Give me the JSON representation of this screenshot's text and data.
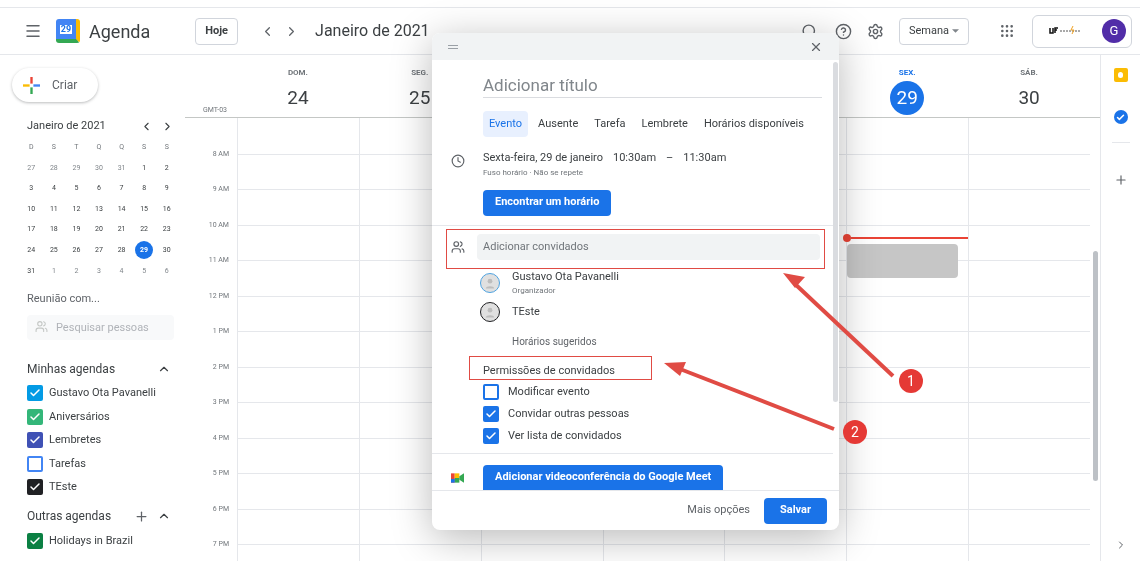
{
  "header": {
    "logo_day": "29",
    "app_name": "Agenda",
    "today_button": "Hoje",
    "period": "Janeiro de 2021",
    "view": "Semana",
    "avatar": "G"
  },
  "sidebar": {
    "create_button": "Criar",
    "mini_calendar": {
      "title": "Janeiro de 2021",
      "weekdays": [
        "D",
        "S",
        "T",
        "Q",
        "Q",
        "S",
        "S"
      ],
      "weeks": [
        [
          {
            "day": "27",
            "outside": true,
            "selected": false
          },
          {
            "day": "28",
            "outside": true,
            "selected": false
          },
          {
            "day": "29",
            "outside": true,
            "selected": false
          },
          {
            "day": "30",
            "outside": true,
            "selected": false
          },
          {
            "day": "31",
            "outside": true,
            "selected": false
          },
          {
            "day": "1",
            "outside": false,
            "selected": false
          },
          {
            "day": "2",
            "outside": false,
            "selected": false
          }
        ],
        [
          {
            "day": "3",
            "outside": false,
            "selected": false
          },
          {
            "day": "4",
            "outside": false,
            "selected": false
          },
          {
            "day": "5",
            "outside": false,
            "selected": false
          },
          {
            "day": "6",
            "outside": false,
            "selected": false
          },
          {
            "day": "7",
            "outside": false,
            "selected": false
          },
          {
            "day": "8",
            "outside": false,
            "selected": false
          },
          {
            "day": "9",
            "outside": false,
            "selected": false
          }
        ],
        [
          {
            "day": "10",
            "outside": false,
            "selected": false
          },
          {
            "day": "11",
            "outside": false,
            "selected": false
          },
          {
            "day": "12",
            "outside": false,
            "selected": false
          },
          {
            "day": "13",
            "outside": false,
            "selected": false
          },
          {
            "day": "14",
            "outside": false,
            "selected": false
          },
          {
            "day": "15",
            "outside": false,
            "selected": false
          },
          {
            "day": "16",
            "outside": false,
            "selected": false
          }
        ],
        [
          {
            "day": "17",
            "outside": false,
            "selected": false
          },
          {
            "day": "18",
            "outside": false,
            "selected": false
          },
          {
            "day": "19",
            "outside": false,
            "selected": false
          },
          {
            "day": "20",
            "outside": false,
            "selected": false
          },
          {
            "day": "21",
            "outside": false,
            "selected": false
          },
          {
            "day": "22",
            "outside": false,
            "selected": false
          },
          {
            "day": "23",
            "outside": false,
            "selected": false
          }
        ],
        [
          {
            "day": "24",
            "outside": false,
            "selected": false
          },
          {
            "day": "25",
            "outside": false,
            "selected": false
          },
          {
            "day": "26",
            "outside": false,
            "selected": false
          },
          {
            "day": "27",
            "outside": false,
            "selected": false
          },
          {
            "day": "28",
            "outside": false,
            "selected": false
          },
          {
            "day": "29",
            "outside": false,
            "selected": true
          },
          {
            "day": "30",
            "outside": false,
            "selected": false
          }
        ],
        [
          {
            "day": "31",
            "outside": false,
            "selected": false
          },
          {
            "day": "1",
            "outside": true,
            "selected": false
          },
          {
            "day": "2",
            "outside": true,
            "selected": false
          },
          {
            "day": "3",
            "outside": true,
            "selected": false
          },
          {
            "day": "4",
            "outside": true,
            "selected": false
          },
          {
            "day": "5",
            "outside": true,
            "selected": false
          },
          {
            "day": "6",
            "outside": true,
            "selected": false
          }
        ]
      ]
    },
    "meet_with": "Reunião com...",
    "people_search": {
      "placeholder": "Pesquisar pessoas"
    },
    "my_calendars": {
      "title": "Minhas agendas",
      "expanded": true,
      "items": [
        {
          "name": "Gustavo Ota Pavanelli",
          "checked": true,
          "color": "#039be5"
        },
        {
          "name": "Aniversários",
          "checked": true,
          "color": "#33b679"
        },
        {
          "name": "Lembretes",
          "checked": true,
          "color": "#3f51b5"
        },
        {
          "name": "Tarefas",
          "checked": false,
          "color": "#4285f4"
        },
        {
          "name": "TEste",
          "checked": true,
          "color": "#202124"
        }
      ]
    },
    "other_calendars": {
      "title": "Outras agendas",
      "expanded": true,
      "items": [
        {
          "name": "Holidays in Brazil",
          "checked": true,
          "color": "#0b8043"
        }
      ]
    }
  },
  "week": {
    "timezone": "GMT-03",
    "days": [
      {
        "weekday": "DOM.",
        "date": "24",
        "selected": false
      },
      {
        "weekday": "SEG.",
        "date": "25",
        "selected": false
      },
      {
        "weekday": "SEX.",
        "date": "29",
        "selected": true
      },
      {
        "weekday": "SÁB.",
        "date": "30",
        "selected": false
      }
    ],
    "hours": [
      "8 AM",
      "9 AM",
      "10 AM",
      "11 AM",
      "12 PM",
      "1 PM",
      "2 PM",
      "3 PM",
      "4 PM",
      "5 PM",
      "6 PM",
      "7 PM"
    ]
  },
  "dialog": {
    "title": {
      "placeholder": "Adicionar título"
    },
    "tabs": [
      {
        "label": "Evento",
        "selected": true
      },
      {
        "label": "Ausente",
        "selected": false
      },
      {
        "label": "Tarefa",
        "selected": false
      },
      {
        "label": "Lembrete",
        "selected": false
      },
      {
        "label": "Horários disponíveis",
        "selected": false
      }
    ],
    "date": "Sexta-feira, 29 de janeiro",
    "start": "10:30am",
    "dash": "–",
    "end": "11:30am",
    "details": "Fuso horário · Não se repete",
    "find_time_button": "Encontrar um horário",
    "guests": {
      "placeholder": "Adicionar convidados"
    },
    "guest_list": [
      {
        "name": "Gustavo Ota Pavanelli",
        "role": "Organizador",
        "kind": "organizer"
      },
      {
        "name": "TEste",
        "kind": "guest"
      }
    ],
    "suggested_times": "Horários sugeridos",
    "permissions_title": "Permissões de convidados",
    "permissions": [
      {
        "label": "Modificar evento",
        "checked": false
      },
      {
        "label": "Convidar outras pessoas",
        "checked": true
      },
      {
        "label": "Ver lista de convidados",
        "checked": true
      }
    ],
    "meet_button": "Adicionar videoconferência do Google Meet",
    "more_options": "Mais opções",
    "save_button": "Salvar"
  },
  "annotations": [
    {
      "label": "1"
    },
    {
      "label": "2"
    }
  ]
}
